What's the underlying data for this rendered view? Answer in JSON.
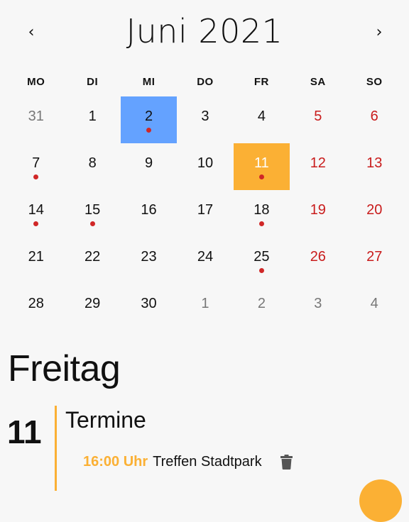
{
  "header": {
    "prev_label": "‹",
    "title": "Juni 2021",
    "next_label": "›"
  },
  "weekdays": [
    "MO",
    "DI",
    "MI",
    "DO",
    "FR",
    "SA",
    "SO"
  ],
  "days": [
    {
      "label": "31",
      "other": true,
      "weekend": false,
      "dot": false
    },
    {
      "label": "1",
      "other": false,
      "weekend": false,
      "dot": false
    },
    {
      "label": "2",
      "other": false,
      "weekend": false,
      "dot": true,
      "state": "today"
    },
    {
      "label": "3",
      "other": false,
      "weekend": false,
      "dot": false
    },
    {
      "label": "4",
      "other": false,
      "weekend": false,
      "dot": false
    },
    {
      "label": "5",
      "other": false,
      "weekend": true,
      "dot": false
    },
    {
      "label": "6",
      "other": false,
      "weekend": true,
      "dot": false
    },
    {
      "label": "7",
      "other": false,
      "weekend": false,
      "dot": true
    },
    {
      "label": "8",
      "other": false,
      "weekend": false,
      "dot": false
    },
    {
      "label": "9",
      "other": false,
      "weekend": false,
      "dot": false
    },
    {
      "label": "10",
      "other": false,
      "weekend": false,
      "dot": false
    },
    {
      "label": "11",
      "other": false,
      "weekend": false,
      "dot": true,
      "state": "selected"
    },
    {
      "label": "12",
      "other": false,
      "weekend": true,
      "dot": false
    },
    {
      "label": "13",
      "other": false,
      "weekend": true,
      "dot": false
    },
    {
      "label": "14",
      "other": false,
      "weekend": false,
      "dot": true
    },
    {
      "label": "15",
      "other": false,
      "weekend": false,
      "dot": true
    },
    {
      "label": "16",
      "other": false,
      "weekend": false,
      "dot": false
    },
    {
      "label": "17",
      "other": false,
      "weekend": false,
      "dot": false
    },
    {
      "label": "18",
      "other": false,
      "weekend": false,
      "dot": true
    },
    {
      "label": "19",
      "other": false,
      "weekend": true,
      "dot": false
    },
    {
      "label": "20",
      "other": false,
      "weekend": true,
      "dot": false
    },
    {
      "label": "21",
      "other": false,
      "weekend": false,
      "dot": false
    },
    {
      "label": "22",
      "other": false,
      "weekend": false,
      "dot": false
    },
    {
      "label": "23",
      "other": false,
      "weekend": false,
      "dot": false
    },
    {
      "label": "24",
      "other": false,
      "weekend": false,
      "dot": false
    },
    {
      "label": "25",
      "other": false,
      "weekend": false,
      "dot": true
    },
    {
      "label": "26",
      "other": false,
      "weekend": true,
      "dot": false
    },
    {
      "label": "27",
      "other": false,
      "weekend": true,
      "dot": false
    },
    {
      "label": "28",
      "other": false,
      "weekend": false,
      "dot": false
    },
    {
      "label": "29",
      "other": false,
      "weekend": false,
      "dot": false
    },
    {
      "label": "30",
      "other": false,
      "weekend": false,
      "dot": false
    },
    {
      "label": "1",
      "other": true,
      "weekend": false,
      "dot": false
    },
    {
      "label": "2",
      "other": true,
      "weekend": false,
      "dot": false
    },
    {
      "label": "3",
      "other": true,
      "weekend": true,
      "dot": false
    },
    {
      "label": "4",
      "other": true,
      "weekend": true,
      "dot": false
    }
  ],
  "detail": {
    "weekday": "Freitag",
    "day_number": "11",
    "events_heading": "Termine",
    "events": [
      {
        "time": "16:00 Uhr",
        "title": "Treffen Stadtpark",
        "action_icon": "trash-icon"
      }
    ]
  },
  "colors": {
    "accent": "#fbb034",
    "today": "#64a2ff",
    "weekend": "#c91c1c",
    "dot": "#d02727"
  },
  "icons": {
    "event_delete": "trash-icon",
    "fab": "add-icon"
  }
}
